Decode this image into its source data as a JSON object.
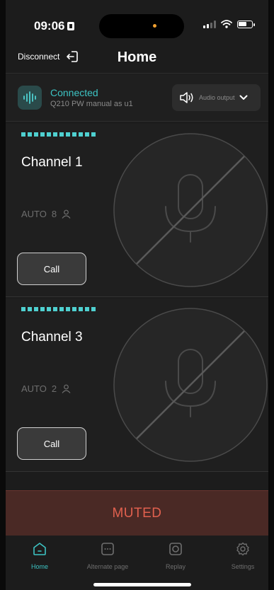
{
  "status_bar": {
    "time": "09:06"
  },
  "header": {
    "disconnect_label": "Disconnect",
    "title": "Home"
  },
  "connection": {
    "status": "Connected",
    "device": "Q210 PW manual as u1",
    "audio_output_label": "Audio output"
  },
  "channels": [
    {
      "name": "Channel 1",
      "mode": "AUTO",
      "count": "8",
      "call_label": "Call",
      "level_segments": 12
    },
    {
      "name": "Channel 3",
      "mode": "AUTO",
      "count": "2",
      "call_label": "Call",
      "level_segments": 12
    }
  ],
  "muted_label": "MUTED",
  "tabs": [
    {
      "label": "Home",
      "icon": "home-icon",
      "active": true
    },
    {
      "label": "Alternate page",
      "icon": "alternate-page-icon",
      "active": false
    },
    {
      "label": "Replay",
      "icon": "replay-icon",
      "active": false
    },
    {
      "label": "Settings",
      "icon": "settings-icon",
      "active": false
    }
  ],
  "colors": {
    "accent": "#3dc3c3",
    "muted_bg": "#4a2925",
    "muted_text": "#e0604e",
    "level": "#4fd0d0"
  }
}
